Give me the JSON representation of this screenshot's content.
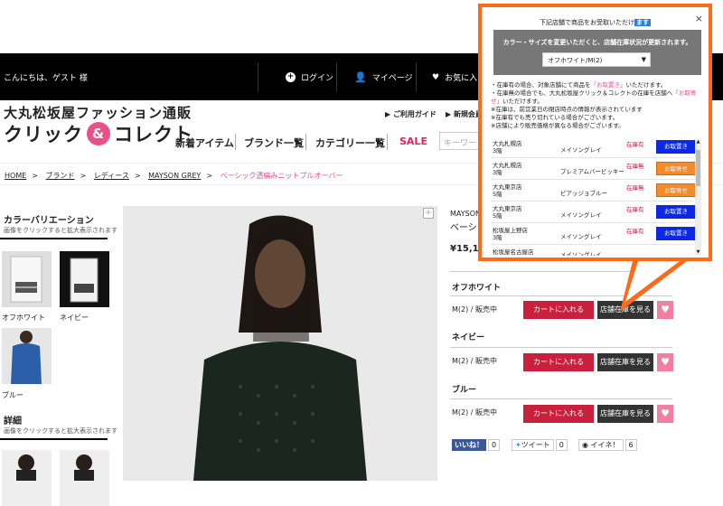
{
  "header": {
    "greeting": "こんにちは、ゲスト 様",
    "login": "ログイン",
    "mypage": "マイページ",
    "favorites": "お気に入り",
    "logo_line1": "大丸松坂屋ファッション通販",
    "logo_left": "クリック",
    "logo_amp": "&",
    "logo_right": "コレクト",
    "guide": "ご利用ガイド",
    "register": "新規会員登"
  },
  "nav": {
    "items": [
      "新着アイテム",
      "ブランド一覧",
      "カテゴリー一覧"
    ],
    "sale": "SALE",
    "search_placeholder": "キーワードで"
  },
  "breadcrumb": [
    "HOME",
    "ブランド",
    "レディース",
    "MAYSON GREY",
    "ベーシック透編みニットプルオーバー"
  ],
  "sidebar": {
    "variation_title": "カラーバリエーション",
    "variation_hint": "画像をクリックすると拡大表示されます",
    "colors": [
      "オフホワイト",
      "ネイビー",
      "ブルー"
    ],
    "detail_title": "詳細",
    "detail_hint": "画像をクリックすると拡大表示されます"
  },
  "product": {
    "brand": "MAYSON G",
    "name": "ベーシッ",
    "price": "¥15,12",
    "variants": [
      {
        "color": "オフホワイト",
        "size": "M(2) / 販売中"
      },
      {
        "color": "ネイビー",
        "size": "M(2) / 販売中"
      },
      {
        "color": "ブルー",
        "size": "M(2) / 販売中"
      }
    ],
    "cart_label": "カートに入れる",
    "store_stock_label": "店舗在庫を見る",
    "heart": "♥"
  },
  "social": {
    "like": "いいね！",
    "like_count": "0",
    "tweet": "ツイート",
    "tweet_count": "0",
    "iine": "イイネ！",
    "iine_count": "6"
  },
  "popup": {
    "title": "下記店舗で商品をお受取いただけ",
    "title_hl": "ます",
    "close": "×",
    "notice": "カラー・サイズを変更いただくと、店舗在庫状況が更新されます。",
    "selected_option": "オフホワイト/M(2)",
    "note1_a": "・在庫有の場合、対象店舗にて商品を",
    "note1_b": "「お取置き」",
    "note1_c": "いただけます。",
    "note2_a": "・在庫無の場合でも、大丸松坂屋クリック＆コレクトの在庫を店舗へ",
    "note2_b": "「お取寄せ」",
    "note2_c": "いただけます。",
    "note3": "※在庫は、前営業日の閉店時点の情報が表示されています",
    "note4": "※在庫有でも売り切れている場合がございます。",
    "note5": "※店舗により販売価格が異なる場合がございます。",
    "stores": [
      {
        "name": "大丸札幌店",
        "floor": "3階",
        "color": "メイソングレイ",
        "stock": "在庫有",
        "action": "お取置き",
        "accent": "#0a28e6"
      },
      {
        "name": "大丸札幌店",
        "floor": "3階",
        "color": "プレミアムバービッキー",
        "stock": "在庫無",
        "action": "お取寄せ",
        "accent": "#f38a2c"
      },
      {
        "name": "大丸東京店",
        "floor": "5階",
        "color": "ピアッジョブルー",
        "stock": "在庫無",
        "action": "お取寄せ",
        "accent": "#f38a2c"
      },
      {
        "name": "大丸東京店",
        "floor": "5階",
        "color": "メイソングレイ",
        "stock": "在庫有",
        "action": "お取置き",
        "accent": "#0a28e6"
      },
      {
        "name": "松坂屋上野店",
        "floor": "3階",
        "color": "メイソングレイ",
        "stock": "在庫有",
        "action": "お取置き",
        "accent": "#0a28e6"
      },
      {
        "name": "松坂屋名古屋店",
        "floor": "",
        "color": "メイソングレイ",
        "stock": "",
        "action": "",
        "accent": ""
      }
    ]
  },
  "colors": {
    "highlight": "#ff6a1a",
    "pink": "#e94f88",
    "cart": "#c9203e",
    "reserve_blue": "#0a28e6"
  }
}
